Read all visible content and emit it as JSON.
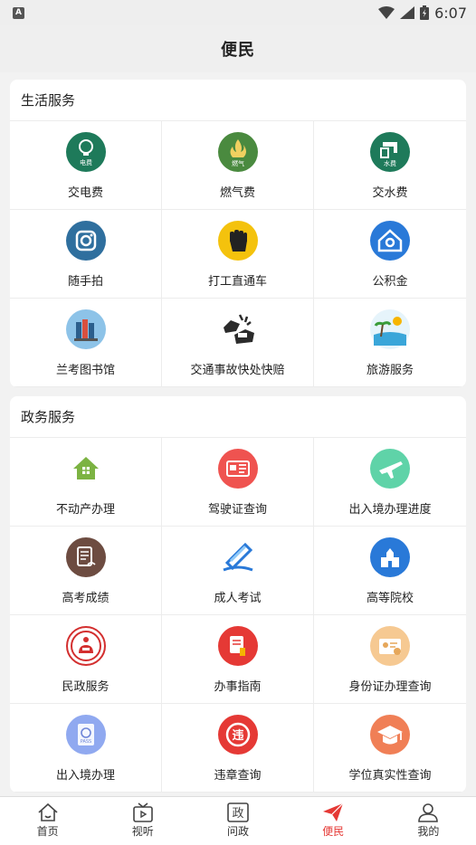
{
  "status": {
    "time": "6:07",
    "badge": "A"
  },
  "header": {
    "title": "便民"
  },
  "life": {
    "title": "生活服务",
    "items": [
      {
        "label": "交电费",
        "icon_text": "电费"
      },
      {
        "label": "燃气费",
        "icon_text": "燃气"
      },
      {
        "label": "交水费",
        "icon_text": "水费"
      },
      {
        "label": "随手拍"
      },
      {
        "label": "打工直通车"
      },
      {
        "label": "公积金"
      },
      {
        "label": "兰考图书馆"
      },
      {
        "label": "交通事故快处快赔"
      },
      {
        "label": "旅游服务"
      }
    ]
  },
  "gov": {
    "title": "政务服务",
    "items": [
      {
        "label": "不动产办理"
      },
      {
        "label": "驾驶证查询"
      },
      {
        "label": "出入境办理进度"
      },
      {
        "label": "高考成绩"
      },
      {
        "label": "成人考试"
      },
      {
        "label": "高等院校"
      },
      {
        "label": "民政服务"
      },
      {
        "label": "办事指南"
      },
      {
        "label": "身份证办理查询"
      },
      {
        "label": "出入境办理",
        "icon_text": "PASS"
      },
      {
        "label": "违章查询",
        "icon_text": "违"
      },
      {
        "label": "学位真实性查询"
      }
    ]
  },
  "tabs": [
    {
      "label": "首页",
      "icon": "home-icon"
    },
    {
      "label": "视听",
      "icon": "tv-icon"
    },
    {
      "label": "问政",
      "icon": "government-icon",
      "icon_text": "政"
    },
    {
      "label": "便民",
      "icon": "paper-plane-icon",
      "active": true
    },
    {
      "label": "我的",
      "icon": "user-icon"
    }
  ],
  "colors": {
    "accent": "#e53935",
    "dark_green": "#1e7a5a",
    "olive_green": "#4a8a3f"
  }
}
